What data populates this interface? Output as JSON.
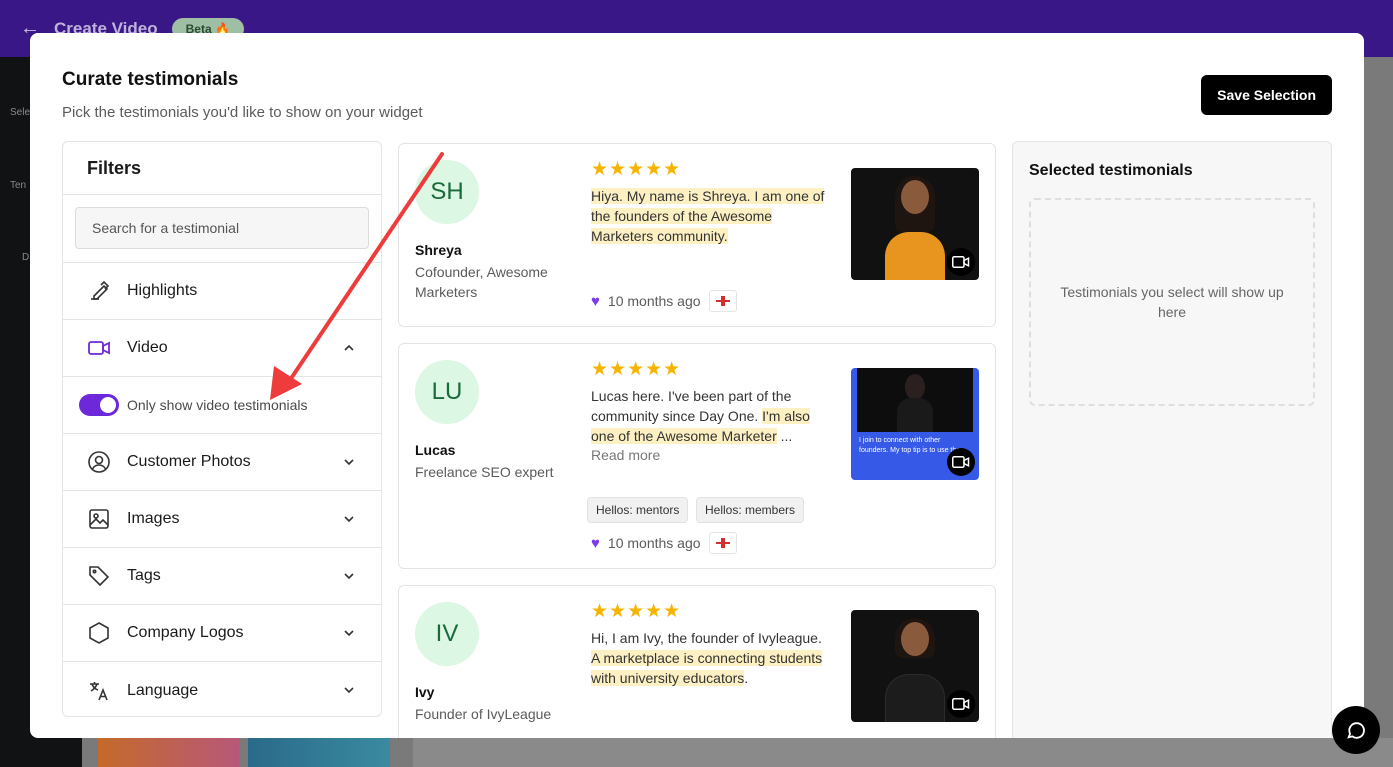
{
  "app": {
    "title": "Create Video",
    "beta_label": "Beta 🔥",
    "rail_labels": [
      "Sele",
      "Ten",
      "D"
    ]
  },
  "modal": {
    "title": "Curate testimonials",
    "subtitle": "Pick the testimonials you'd like to show on your widget",
    "save_label": "Save Selection"
  },
  "filters": {
    "heading": "Filters",
    "search_placeholder": "Search for a testimonial",
    "items": [
      {
        "label": "Highlights",
        "icon": "highlighter-icon"
      },
      {
        "label": "Video",
        "icon": "video-icon",
        "expanded": true
      },
      {
        "label": "Customer Photos",
        "icon": "user-circle-icon"
      },
      {
        "label": "Images",
        "icon": "image-icon"
      },
      {
        "label": "Tags",
        "icon": "tag-icon"
      },
      {
        "label": "Company Logos",
        "icon": "hexagon-icon"
      },
      {
        "label": "Language",
        "icon": "translate-icon"
      }
    ],
    "video_toggle_label": "Only show video testimonials",
    "video_toggle_on": true
  },
  "testimonials": [
    {
      "initials": "SH",
      "name": "Shreya",
      "role": "Cofounder, Awesome Marketers",
      "rating": 5,
      "quote_parts": [
        "Hiya. My name is Shreya. I am one of the founders of the Awesome Marketers community."
      ],
      "time": "10 months ago",
      "shirt_color": "#e8951f"
    },
    {
      "initials": "LU",
      "name": "Lucas",
      "role": "Freelance SEO expert",
      "rating": 5,
      "quote_plain": "Lucas here. I've been part of the community since Day One. ",
      "quote_hl": "I'm also one of the Awesome Marketer",
      "quote_end": " ...",
      "read_more": "Read more",
      "tags": [
        "Hellos: mentors",
        "Hellos: members"
      ],
      "time": "10 months ago",
      "caption": "I join to connect with other founders. My top tip is to use the"
    },
    {
      "initials": "IV",
      "name": "Ivy",
      "role": "Founder of IvyLeague",
      "rating": 5,
      "quote_plain": "Hi, I am Ivy, the founder of Ivyleague. ",
      "quote_hl": "A marketplace is connecting students with university educators",
      "quote_end": ".",
      "shirt_color": "#1c1c1c"
    }
  ],
  "selected": {
    "heading": "Selected testimonials",
    "empty_text": "Testimonials you select will show up here"
  },
  "colors": {
    "accent": "#6d28d9",
    "star": "#f5b400",
    "highlight": "#fdf1c4",
    "avatar_bg": "#dcf7e4"
  }
}
